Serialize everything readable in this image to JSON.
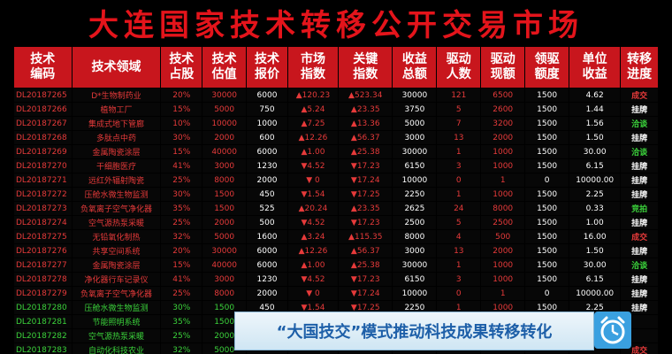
{
  "title": "大连国家技术转移公开交易市场",
  "headers": [
    "技术\n编码",
    "技术领域",
    "技术\n占股",
    "技术\n估值",
    "技术\n报价",
    "市场\n指数",
    "关键\n指数",
    "收益\n总额",
    "驱动\n人数",
    "驱动\n现额",
    "领驱\n额度",
    "单位\n收益",
    "转移\n进度"
  ],
  "rows": [
    {
      "green": false,
      "cells": [
        "DL20187265",
        "D*生物制药业",
        "20%",
        "30000",
        "6000",
        "▲120.23",
        "▲523.34",
        "30000",
        "121",
        "6500",
        "1500",
        "4.62",
        "成交"
      ]
    },
    {
      "green": false,
      "cells": [
        "DL20187266",
        "植物工厂",
        "15%",
        "5000",
        "750",
        "▲5.24",
        "▲23.35",
        "3750",
        "5",
        "2600",
        "1500",
        "1.44",
        "挂牌"
      ]
    },
    {
      "green": false,
      "cells": [
        "DL20187267",
        "集成式地下管廊",
        "10%",
        "10000",
        "1000",
        "▲7.25",
        "▲13.36",
        "5000",
        "7",
        "3200",
        "1500",
        "1.56",
        "洽谈"
      ]
    },
    {
      "green": false,
      "cells": [
        "DL20187268",
        "多肽点中药",
        "30%",
        "2000",
        "600",
        "▲12.26",
        "▲56.37",
        "3000",
        "13",
        "2000",
        "1500",
        "1.50",
        "挂牌"
      ]
    },
    {
      "green": false,
      "cells": [
        "DL20187269",
        "金属陶瓷涂层",
        "15%",
        "40000",
        "6000",
        "▲1.00",
        "▲25.38",
        "30000",
        "1",
        "1000",
        "1500",
        "30.00",
        "洽谈"
      ]
    },
    {
      "green": false,
      "cells": [
        "DL20187270",
        "干细胞医疗",
        "41%",
        "3000",
        "1230",
        "▼4.52",
        "▼17.23",
        "6150",
        "3",
        "1000",
        "1500",
        "6.15",
        "挂牌"
      ]
    },
    {
      "green": false,
      "cells": [
        "DL20187271",
        "远红外辐射陶瓷",
        "25%",
        "8000",
        "2000",
        "▼ 0",
        "▼17.24",
        "10000",
        "0",
        "1",
        "0",
        "10000.00",
        "挂牌"
      ]
    },
    {
      "green": false,
      "cells": [
        "DL20187272",
        "压舱水微生物监测",
        "30%",
        "1500",
        "450",
        "▼1.54",
        "▼17.25",
        "2250",
        "1",
        "1000",
        "1500",
        "2.25",
        "挂牌"
      ]
    },
    {
      "green": false,
      "cells": [
        "DL20187273",
        "负氧离子空气净化器",
        "35%",
        "1500",
        "525",
        "▲20.24",
        "▲23.35",
        "2625",
        "24",
        "8000",
        "1500",
        "0.33",
        "竞拍"
      ]
    },
    {
      "green": false,
      "cells": [
        "DL20187274",
        "空气源热泵采暖",
        "25%",
        "2000",
        "500",
        "▼4.52",
        "▼17.23",
        "2500",
        "5",
        "2500",
        "1500",
        "1.00",
        "挂牌"
      ]
    },
    {
      "green": false,
      "cells": [
        "DL20187275",
        "无铅氧化制热",
        "32%",
        "5000",
        "1600",
        "▲3.24",
        "▲115.35",
        "8000",
        "4",
        "500",
        "1500",
        "16.00",
        "成交"
      ]
    },
    {
      "green": false,
      "cells": [
        "DL20187276",
        "共享空间系统",
        "20%",
        "30000",
        "6000",
        "▲12.26",
        "▲56.37",
        "3000",
        "13",
        "2000",
        "1500",
        "1.50",
        "挂牌"
      ]
    },
    {
      "green": false,
      "cells": [
        "DL20187277",
        "金属陶瓷涂层",
        "15%",
        "40000",
        "6000",
        "▲1.00",
        "▲25.38",
        "30000",
        "1",
        "1000",
        "1500",
        "30.00",
        "洽谈"
      ]
    },
    {
      "green": false,
      "cells": [
        "DL20187278",
        "净化器行车记录仪",
        "41%",
        "3000",
        "1230",
        "▼4.52",
        "▼17.23",
        "6150",
        "3",
        "1000",
        "1500",
        "6.15",
        "挂牌"
      ]
    },
    {
      "green": false,
      "cells": [
        "DL20187279",
        "负氧离子空气净化器",
        "25%",
        "8000",
        "2000",
        "▼ 0",
        "▼17.24",
        "10000",
        "0",
        "1",
        "0",
        "10000.00",
        "挂牌"
      ]
    },
    {
      "green": true,
      "cells": [
        "DL20187280",
        "压舱水微生物监测",
        "30%",
        "1500",
        "450",
        "▼1.54",
        "▼17.25",
        "2250",
        "1",
        "1000",
        "1500",
        "2.25",
        "挂牌"
      ]
    },
    {
      "green": true,
      "cells": [
        "DL20187281",
        "节能照明系统",
        "35%",
        "1500",
        "",
        "",
        "",
        "",
        "",
        "",
        "",
        "",
        ""
      ]
    },
    {
      "green": true,
      "cells": [
        "DL20187282",
        "空气源热泵采暖",
        "25%",
        "2000",
        "",
        "",
        "",
        "",
        "",
        "",
        "",
        "",
        ""
      ]
    },
    {
      "green": true,
      "cells": [
        "DL20187283",
        "自动化科技农业",
        "32%",
        "5000",
        "",
        "",
        "",
        "",
        "",
        "",
        "",
        "",
        "成交"
      ]
    }
  ],
  "banner": "“大国技交”模式推动科技成果转移转化",
  "colors": {
    "header_red": "#c8161d",
    "title_red": "#e4141b",
    "green": "#3bd23b",
    "up_red": "#e63a3a"
  }
}
